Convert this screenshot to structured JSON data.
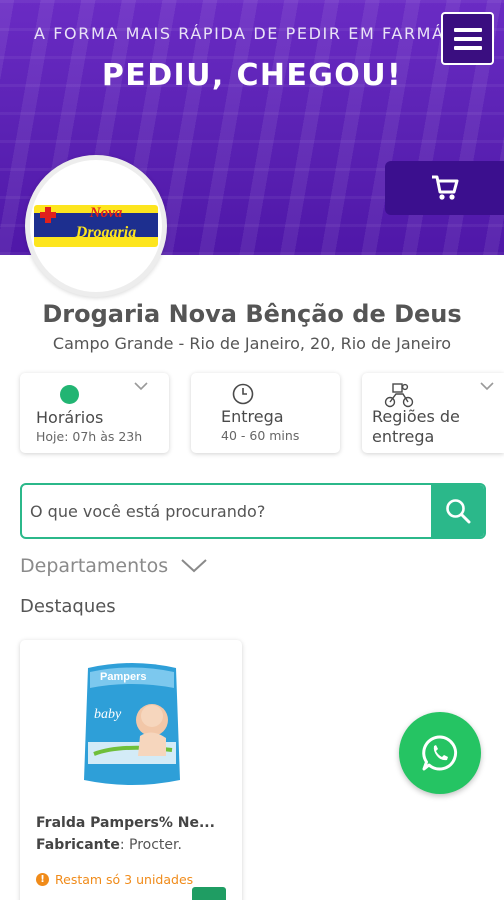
{
  "hero": {
    "tagline": "A FORMA MAIS RÁPIDA DE PEDIR EM FARMÁCIA",
    "headline": "PEDIU, CHEGOU!"
  },
  "icons": {
    "menu": "hamburger-menu-icon",
    "cart": "shopping-cart-icon",
    "search": "search-icon",
    "whatsapp": "whatsapp-icon",
    "clock": "clock-icon",
    "delivery": "delivery-bike-icon",
    "chevron": "chevron-down-icon",
    "alert": "alert-circle-icon"
  },
  "logo": {
    "line1": "Nova",
    "line2": "Drogaria"
  },
  "store": {
    "name": "Drogaria Nova Bênção de Deus",
    "address": "Campo Grande - Rio de Janeiro, 20, Rio de Janeiro"
  },
  "info_cards": {
    "hours": {
      "title": "Horários",
      "subtitle": "Hoje: 07h às 23h",
      "status_color": "#22b573"
    },
    "delivery": {
      "title": "Entrega",
      "subtitle": "40 - 60 mins"
    },
    "regions": {
      "title_line1": "Regiões de",
      "title_line2": "entrega"
    }
  },
  "search": {
    "placeholder": "O que você está procurando?",
    "value": ""
  },
  "departments": {
    "label": "Departamentos"
  },
  "highlights": {
    "title": "Destaques",
    "products": [
      {
        "name": "Fralda Pampers% Ne...",
        "maker_label": "Fabricante",
        "maker_value": ": Procter.",
        "stock_text": "Restam só 3 unidades",
        "pack_brand": "Pampers",
        "pack_text": "baby"
      }
    ]
  },
  "colors": {
    "brand_purple": "#5a1fb0",
    "accent_green": "#2bb88a",
    "whatsapp_green": "#25c463",
    "stock_orange": "#f08b1a"
  }
}
